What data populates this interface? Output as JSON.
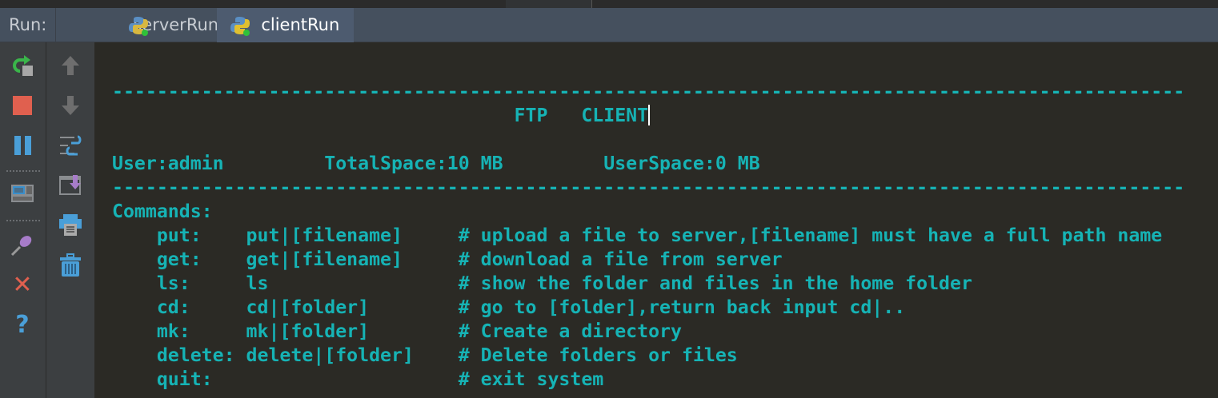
{
  "run_panel": {
    "label": "Run:",
    "tabs": [
      {
        "label": "serverRun",
        "active": false,
        "icon": "python-icon"
      },
      {
        "label": "clientRun",
        "active": true,
        "icon": "python-icon"
      }
    ]
  },
  "toolbar_left": [
    "rerun-icon",
    "stop-icon",
    "pause-icon",
    "layout-icon",
    "pin-icon",
    "close-icon",
    "help-icon"
  ],
  "toolbar_right": [
    "up-arrow-icon",
    "down-arrow-icon",
    "soft-wrap-icon",
    "scroll-to-end-icon",
    "print-icon",
    "trash-icon"
  ],
  "colors": {
    "console_text": "#16b3b5",
    "console_bg": "#2b2a25",
    "tabbar": "#45505e"
  },
  "console": {
    "lines": [
      "",
      "------------------------------------------------------------------------------------------------",
      "                                    FTP   CLIENT",
      "",
      "User:admin         TotalSpace:10 MB         UserSpace:0 MB",
      "------------------------------------------------------------------------------------------------",
      "Commands:",
      "    put:    put|[filename]     # upload a file to server,[filename] must have a full path name",
      "    get:    get|[filename]     # download a file from server",
      "    ls:     ls                 # show the folder and files in the home folder",
      "    cd:     cd|[folder]        # go to [folder],return back input cd|..",
      "    mk:     mk|[folder]        # Create a directory",
      "    delete: delete|[folder]    # Delete folders or files",
      "    quit:                      # exit system"
    ]
  }
}
